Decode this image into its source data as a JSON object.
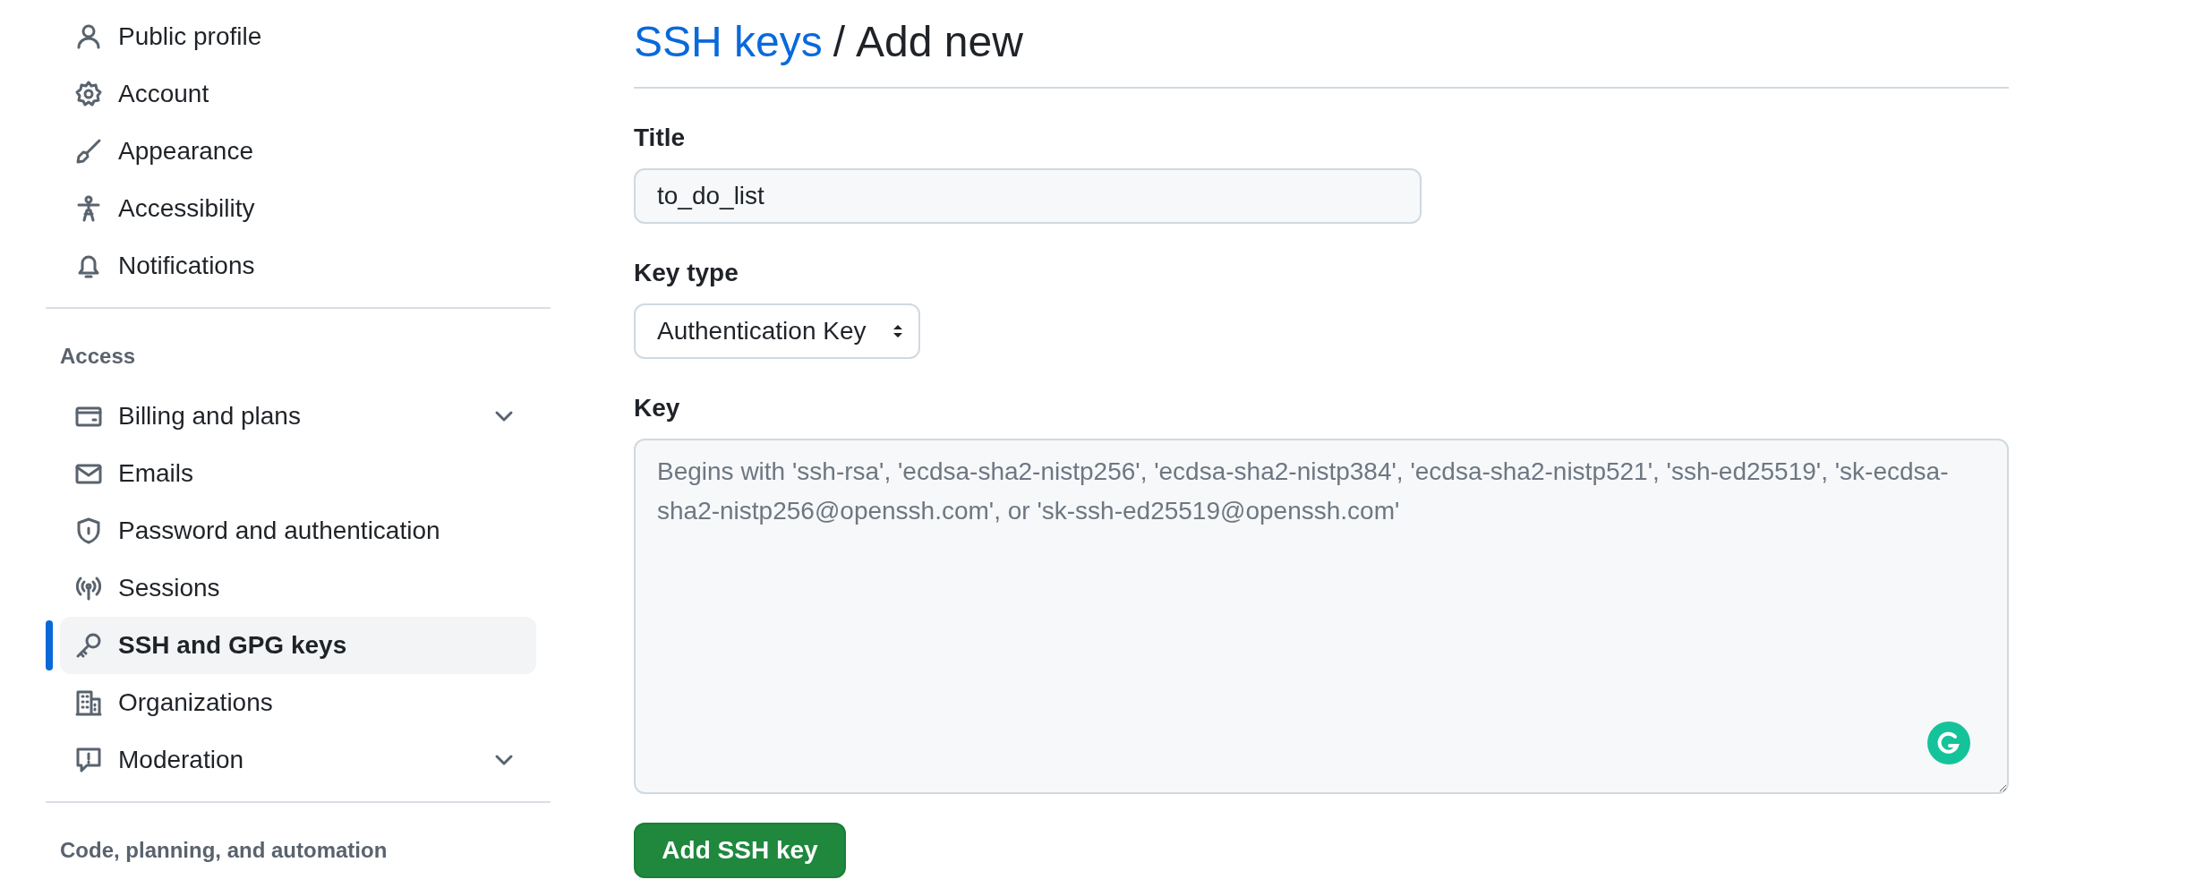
{
  "sidebar": {
    "sections": [
      {
        "items": [
          {
            "label": "Public profile",
            "selected": false,
            "collapsible": false
          },
          {
            "label": "Account",
            "selected": false,
            "collapsible": false
          },
          {
            "label": "Appearance",
            "selected": false,
            "collapsible": false
          },
          {
            "label": "Accessibility",
            "selected": false,
            "collapsible": false
          },
          {
            "label": "Notifications",
            "selected": false,
            "collapsible": false
          }
        ]
      },
      {
        "heading": "Access",
        "items": [
          {
            "label": "Billing and plans",
            "selected": false,
            "collapsible": true
          },
          {
            "label": "Emails",
            "selected": false,
            "collapsible": false
          },
          {
            "label": "Password and authentication",
            "selected": false,
            "collapsible": false
          },
          {
            "label": "Sessions",
            "selected": false,
            "collapsible": false
          },
          {
            "label": "SSH and GPG keys",
            "selected": true,
            "collapsible": false
          },
          {
            "label": "Organizations",
            "selected": false,
            "collapsible": false
          },
          {
            "label": "Moderation",
            "selected": false,
            "collapsible": true
          }
        ]
      },
      {
        "heading": "Code, planning, and automation"
      }
    ]
  },
  "breadcrumb": {
    "link": "SSH keys",
    "separator": "/",
    "current": "Add new"
  },
  "form": {
    "title": {
      "label": "Title",
      "value": "to_do_list"
    },
    "key_type": {
      "label": "Key type",
      "value": "Authentication Key"
    },
    "key": {
      "label": "Key",
      "placeholder": "Begins with 'ssh-rsa', 'ecdsa-sha2-nistp256', 'ecdsa-sha2-nistp384', 'ecdsa-sha2-nistp521', 'ssh-ed25519', 'sk-ecdsa-sha2-nistp256@openssh.com', or 'sk-ssh-ed25519@openssh.com'"
    },
    "submit": "Add SSH key"
  }
}
